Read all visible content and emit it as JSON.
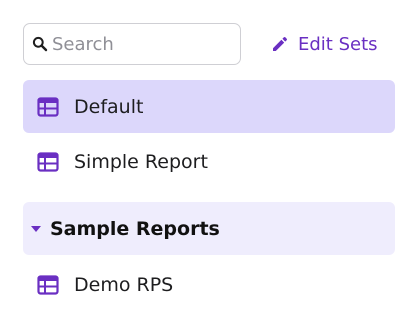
{
  "search": {
    "placeholder": "Search",
    "value": ""
  },
  "edit_sets": {
    "label": "Edit Sets"
  },
  "items": [
    {
      "label": "Default",
      "selected": true
    },
    {
      "label": "Simple Report",
      "selected": false
    }
  ],
  "group": {
    "label": "Sample Reports",
    "expanded": true,
    "items": [
      {
        "label": "Demo RPS"
      }
    ]
  },
  "colors": {
    "accent": "#6a2fc2",
    "selected_bg": "#dcd7fb",
    "group_bg": "#efedfd"
  },
  "icons": {
    "search": "search-icon",
    "edit": "pencil-icon",
    "report": "table-icon",
    "group_toggle": "caret-down-icon"
  }
}
